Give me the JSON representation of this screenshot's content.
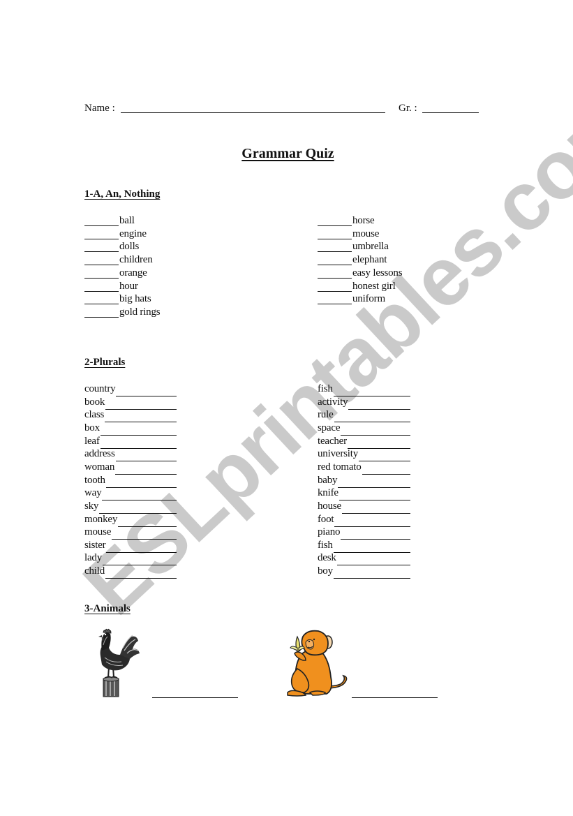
{
  "header": {
    "name_label": "Name :",
    "grade_label": "Gr. :"
  },
  "title": "Grammar Quiz",
  "watermark": "ESLprintables.com",
  "section1": {
    "heading": "1-A, An, Nothing",
    "left_items": [
      "ball",
      "engine",
      "dolls",
      "children",
      "orange",
      "hour",
      "big hats",
      "gold rings"
    ],
    "right_items": [
      "horse",
      "mouse",
      "umbrella",
      "elephant",
      "easy lessons",
      "honest girl",
      "uniform"
    ]
  },
  "section2": {
    "heading": "2-Plurals",
    "left_items": [
      "country",
      "book",
      "class",
      "box",
      "leaf",
      "address",
      "woman",
      "tooth",
      "way",
      "sky",
      "monkey",
      "mouse",
      "sister",
      "lady",
      "child"
    ],
    "right_items": [
      "fish",
      "activity",
      "rule",
      "space",
      "teacher",
      "university",
      "red tomato",
      "baby",
      "knife",
      "house",
      "foot",
      "piano",
      "fish",
      "desk",
      "boy"
    ]
  },
  "section3": {
    "heading": "3-Animals",
    "animals": [
      {
        "icon": "rooster-icon"
      },
      {
        "icon": "monkey-icon"
      }
    ]
  },
  "colors": {
    "text": "#111111",
    "watermark": "#cacaca",
    "monkey_fur": "#f0901e"
  }
}
